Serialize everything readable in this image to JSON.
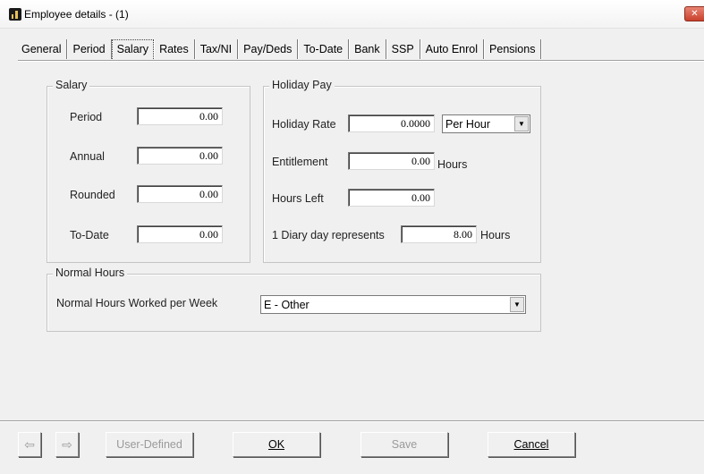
{
  "window": {
    "title": "Employee details -  (1)",
    "icon": "payroll-app-icon",
    "close_icon": "close-x-icon",
    "close_label": "✕"
  },
  "tabs": [
    {
      "label": "General",
      "active": false
    },
    {
      "label": "Period",
      "active": false
    },
    {
      "label": "Salary",
      "active": true
    },
    {
      "label": "Rates",
      "active": false
    },
    {
      "label": "Tax/NI",
      "active": false
    },
    {
      "label": "Pay/Deds",
      "active": false
    },
    {
      "label": "To-Date",
      "active": false
    },
    {
      "label": "Bank",
      "active": false
    },
    {
      "label": "SSP",
      "active": false
    },
    {
      "label": "Auto Enrol",
      "active": false
    },
    {
      "label": "Pensions",
      "active": false
    }
  ],
  "salary": {
    "group_title": "Salary",
    "period": {
      "label": "Period",
      "value": "0.00"
    },
    "annual": {
      "label": "Annual",
      "value": "0.00"
    },
    "rounded": {
      "label": "Rounded",
      "value": "0.00"
    },
    "to_date": {
      "label": "To-Date",
      "value": "0.00"
    }
  },
  "holiday_pay": {
    "group_title": "Holiday Pay",
    "holiday_rate": {
      "label": "Holiday Rate",
      "value": "0.0000",
      "unit_select": "Per Hour"
    },
    "entitlement": {
      "label": "Entitlement",
      "value": "0.00",
      "unit": "Hours"
    },
    "hours_left": {
      "label": "Hours Left",
      "value": "0.00"
    },
    "diary_day": {
      "label": "1 Diary day represents",
      "value": "8.00",
      "unit": "Hours"
    }
  },
  "normal_hours": {
    "group_title": "Normal Hours",
    "label": "Normal Hours Worked per Week",
    "selected": "E - Other"
  },
  "buttons": {
    "prev_icon": "arrow-left-icon",
    "next_icon": "arrow-right-icon",
    "prev_glyph": "⇦",
    "next_glyph": "⇨",
    "user_defined": "User-Defined",
    "ok": "OK",
    "save": "Save",
    "cancel": "Cancel"
  }
}
